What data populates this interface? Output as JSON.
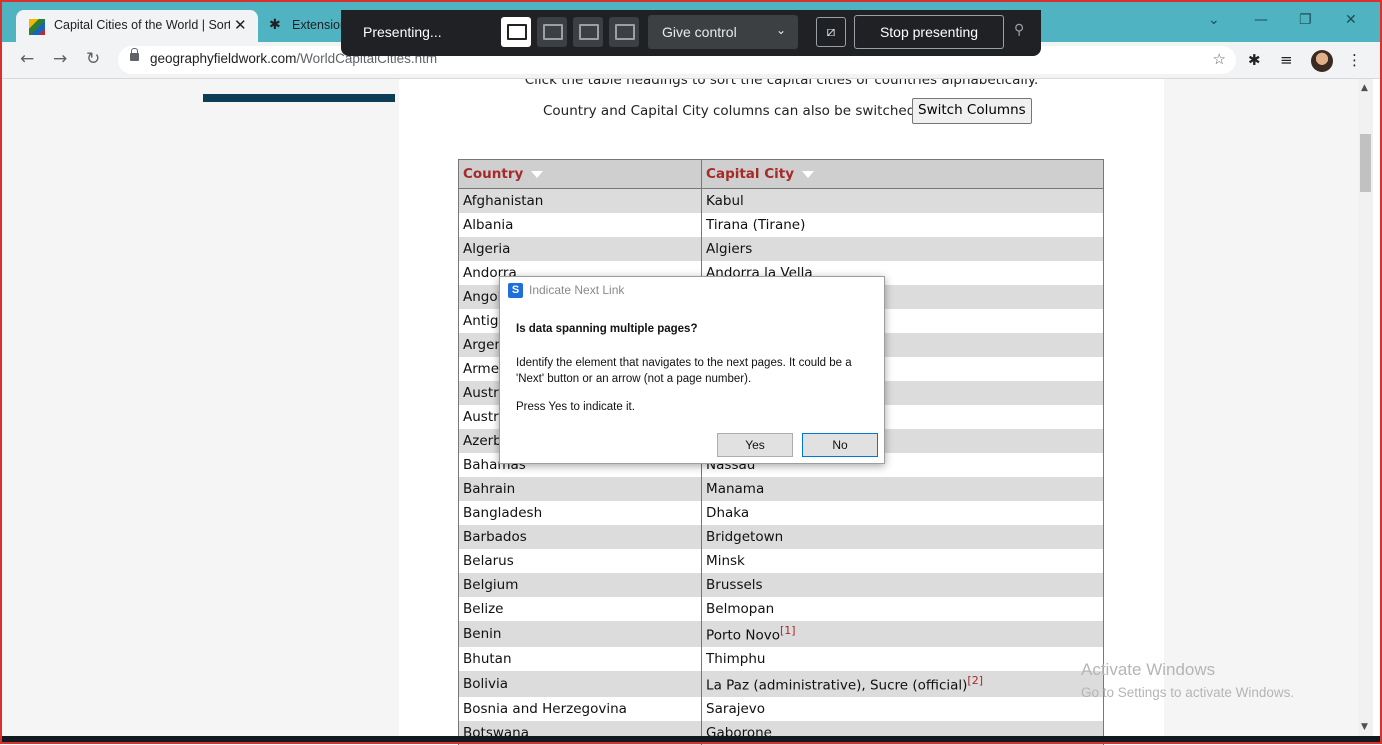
{
  "browser": {
    "tabs": [
      {
        "label": "Capital Cities of the World | Sorta"
      },
      {
        "label": "Extension"
      }
    ],
    "close_glyph": "✕",
    "url_host": "geographyfieldwork.com",
    "url_path": "/WorldCapitalCities.htm"
  },
  "presenting": {
    "label": "Presenting...",
    "give_control_label": "Give control",
    "stop_label": "Stop presenting"
  },
  "page": {
    "instruction": "Click the table headings to sort the capital cities or countries alphabetically.",
    "switch_text": "Country and Capital City columns can also be switched:",
    "switch_button": "Switch Columns"
  },
  "table": {
    "headers": [
      "Country",
      "Capital City"
    ],
    "rows": [
      [
        "Afghanistan",
        "Kabul"
      ],
      [
        "Albania",
        "Tirana (Tirane)"
      ],
      [
        "Algeria",
        "Algiers"
      ],
      [
        "Andorra",
        "Andorra la Vella"
      ],
      [
        "Angola",
        ""
      ],
      [
        "Antigua",
        ""
      ],
      [
        "Argentina",
        ""
      ],
      [
        "Armenia",
        ""
      ],
      [
        "Australia",
        ""
      ],
      [
        "Austria",
        ""
      ],
      [
        "Azerbaijan",
        ""
      ],
      [
        "Bahamas",
        "Nassau"
      ],
      [
        "Bahrain",
        "Manama"
      ],
      [
        "Bangladesh",
        "Dhaka"
      ],
      [
        "Barbados",
        "Bridgetown"
      ],
      [
        "Belarus",
        "Minsk"
      ],
      [
        "Belgium",
        "Brussels"
      ],
      [
        "Belize",
        "Belmopan"
      ],
      [
        "Benin",
        "Porto Novo"
      ],
      [
        "Bhutan",
        "Thimphu"
      ],
      [
        "Bolivia",
        "La Paz (administrative), Sucre (official)"
      ],
      [
        "Bosnia and Herzegovina",
        "Sarajevo"
      ],
      [
        "Botswana",
        "Gaborone"
      ]
    ],
    "footnotes": {
      "benin": "[1]",
      "bolivia": "[2]"
    }
  },
  "dialog": {
    "title": "Indicate Next Link",
    "question": "Is data spanning multiple pages?",
    "body": "Identify the element that navigates to the next pages. It could be a 'Next' button or an arrow (not a page number).",
    "press": "Press Yes to indicate it.",
    "yes_label": "Yes",
    "no_label": "No"
  },
  "watermark": {
    "line1": "Activate Windows",
    "line2": "Go to Settings to activate Windows."
  },
  "colors": {
    "tab_strip": "#4fb3c1",
    "header_text": "#a52a2a",
    "presenting_bar": "#202124",
    "frame_border": "#d93030"
  },
  "icons": [
    "site-favicon",
    "puzzle-icon",
    "back-icon",
    "forward-icon",
    "reload-icon",
    "lock-icon",
    "star-icon",
    "extensions-icon",
    "media-icon",
    "menu-icon"
  ]
}
